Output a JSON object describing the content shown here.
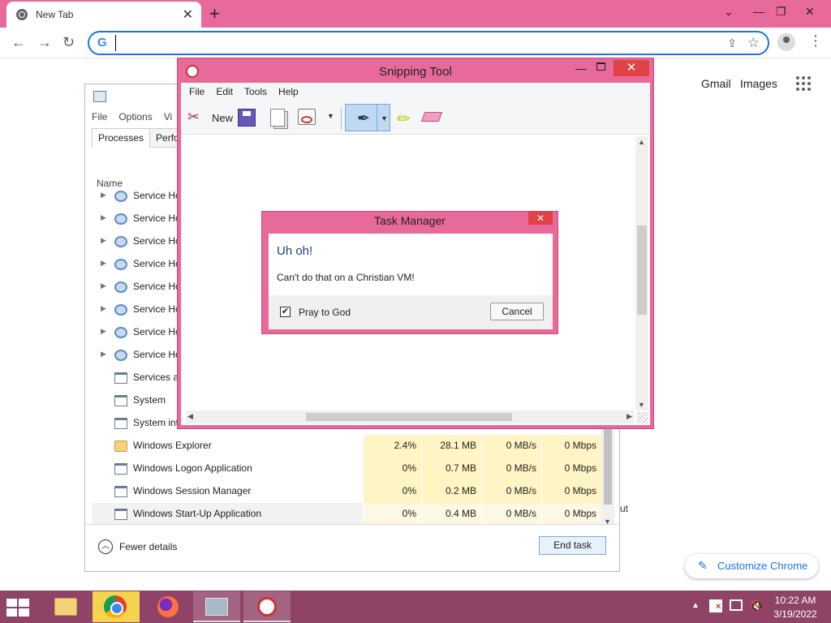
{
  "browser": {
    "tab_title": "New Tab",
    "omnibox_value": "",
    "links": {
      "gmail": "Gmail",
      "images": "Images"
    },
    "customize_label": "Customize Chrome"
  },
  "task_manager": {
    "menu": [
      "File",
      "Options",
      "Vi"
    ],
    "tabs": [
      "Processes",
      "Perfor"
    ],
    "column_name": "Name",
    "processes": [
      {
        "name": "Service Ho",
        "icon": "gear-icon",
        "expandable": true
      },
      {
        "name": "Service Ho",
        "icon": "gear-icon",
        "expandable": true
      },
      {
        "name": "Service Ho",
        "icon": "gear-icon",
        "expandable": true
      },
      {
        "name": "Service Ho",
        "icon": "gear-icon",
        "expandable": true
      },
      {
        "name": "Service Ho",
        "icon": "gear-icon",
        "expandable": true
      },
      {
        "name": "Service Ho",
        "icon": "gear-icon",
        "expandable": true
      },
      {
        "name": "Service Ho",
        "icon": "gear-icon",
        "expandable": true
      },
      {
        "name": "Service Ho",
        "icon": "gear-icon",
        "expandable": true
      },
      {
        "name": "Services ar",
        "icon": "window-icon",
        "expandable": false
      },
      {
        "name": "System",
        "icon": "window-icon",
        "expandable": false
      },
      {
        "name": "System int",
        "icon": "window-icon",
        "expandable": false
      },
      {
        "name": "Windows Explorer",
        "icon": "folder-icon",
        "expandable": false,
        "cpu": "2.4%",
        "memory": "28.1 MB",
        "disk": "0 MB/s",
        "network": "0 Mbps"
      },
      {
        "name": "Windows Logon Application",
        "icon": "window-icon",
        "expandable": false,
        "cpu": "0%",
        "memory": "0.7 MB",
        "disk": "0 MB/s",
        "network": "0 Mbps"
      },
      {
        "name": "Windows Session Manager",
        "icon": "window-icon",
        "expandable": false,
        "cpu": "0%",
        "memory": "0.2 MB",
        "disk": "0 MB/s",
        "network": "0 Mbps"
      },
      {
        "name": "Windows Start-Up Application",
        "icon": "window-icon",
        "expandable": false,
        "selected": true,
        "cpu": "0%",
        "memory": "0.4 MB",
        "disk": "0 MB/s",
        "network": "0 Mbps"
      }
    ],
    "fewer_details": "Fewer details",
    "end_task": "End task",
    "stray_text": "ut"
  },
  "snipping_tool": {
    "title": "Snipping Tool",
    "menu": [
      "File",
      "Edit",
      "Tools",
      "Help"
    ],
    "new_label": "New"
  },
  "dialog": {
    "title": "Task Manager",
    "heading": "Uh oh!",
    "message": "Can't do that on a Christian VM!",
    "checkbox_label": "Pray to God",
    "checkbox_checked": true,
    "cancel_label": "Cancel"
  },
  "taskbar": {
    "time": "10:22 AM",
    "date": "3/19/2022",
    "apps": [
      "file-explorer-icon",
      "chrome-icon",
      "firefox-icon",
      "task-manager-icon",
      "snipping-tool-icon"
    ]
  },
  "colors": {
    "accent_pink": "#e86a9a",
    "taskbar": "#8e4367",
    "close_red": "#e04343",
    "link_blue": "#1a73e8"
  }
}
